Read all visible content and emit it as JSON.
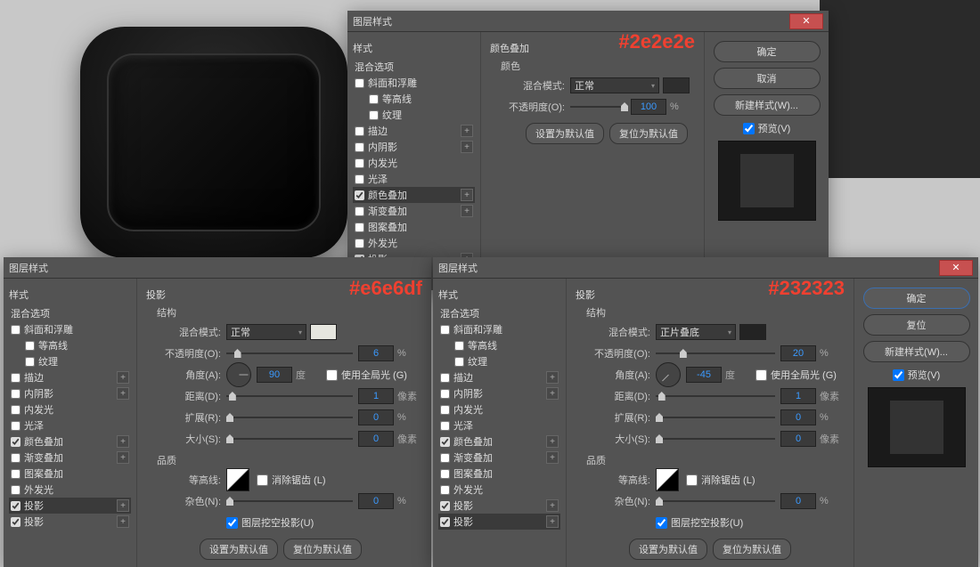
{
  "dialogTitle": "图层样式",
  "colors": {
    "anno1": "#2e2e2e",
    "anno2": "#e6e6df",
    "anno3": "#232323"
  },
  "styles": {
    "header": "样式",
    "blendOpts": "混合选项",
    "items": [
      {
        "k": "斜面和浮雕",
        "c": false,
        "p": false
      },
      {
        "k": "等高线",
        "c": false,
        "i": true,
        "p": false
      },
      {
        "k": "纹理",
        "c": false,
        "i": true,
        "p": false
      },
      {
        "k": "描边",
        "c": false,
        "p": true
      },
      {
        "k": "内阴影",
        "c": false,
        "p": true
      },
      {
        "k": "内发光",
        "c": false,
        "p": false
      },
      {
        "k": "光泽",
        "c": false,
        "p": false
      },
      {
        "k": "颜色叠加",
        "c": true,
        "p": true
      },
      {
        "k": "渐变叠加",
        "c": false,
        "p": true
      },
      {
        "k": "图案叠加",
        "c": false,
        "p": false
      },
      {
        "k": "外发光",
        "c": false,
        "p": false
      },
      {
        "k": "投影",
        "c": true,
        "p": true
      },
      {
        "k": "投影",
        "c": true,
        "p": true
      }
    ]
  },
  "colorOverlay": {
    "title": "颜色叠加",
    "sub": "颜色",
    "blendLabel": "混合模式:",
    "blendVal": "正常",
    "opLabel": "不透明度(O):",
    "opVal": "100",
    "opUnit": "%",
    "btnDefault": "设置为默认值",
    "btnReset": "复位为默认值",
    "swatch": "#2e2e2e"
  },
  "shadowA": {
    "title": "投影",
    "sub": "结构",
    "blendLabel": "混合模式:",
    "blendVal": "正常",
    "swatch": "#e6e6df",
    "opLabel": "不透明度(O):",
    "opVal": "6",
    "opUnit": "%",
    "angLabel": "角度(A):",
    "angVal": "90",
    "angUnit": "度",
    "globalLabel": "使用全局光 (G)",
    "global": false,
    "distLabel": "距离(D):",
    "distVal": "1",
    "distUnit": "像素",
    "sprLabel": "扩展(R):",
    "sprVal": "0",
    "sprUnit": "%",
    "sizeLabel": "大小(S):",
    "sizeVal": "0",
    "sizeUnit": "像素",
    "quality": "品质",
    "contLabel": "等高线:",
    "aaLabel": "消除锯齿 (L)",
    "aa": false,
    "noiseLabel": "杂色(N):",
    "noiseVal": "0",
    "noiseUnit": "%",
    "knockLabel": "图层挖空投影(U)",
    "knock": true,
    "btnDefault": "设置为默认值",
    "btnReset": "复位为默认值"
  },
  "shadowB": {
    "title": "投影",
    "sub": "结构",
    "blendLabel": "混合模式:",
    "blendVal": "正片叠底",
    "swatch": "#232323",
    "opLabel": "不透明度(O):",
    "opVal": "20",
    "opUnit": "%",
    "angLabel": "角度(A):",
    "angVal": "-45",
    "angUnit": "度",
    "globalLabel": "使用全局光 (G)",
    "global": false,
    "distLabel": "距离(D):",
    "distVal": "1",
    "distUnit": "像素",
    "sprLabel": "扩展(R):",
    "sprVal": "0",
    "sprUnit": "%",
    "sizeLabel": "大小(S):",
    "sizeVal": "0",
    "sizeUnit": "像素",
    "quality": "品质",
    "contLabel": "等高线:",
    "aaLabel": "消除锯齿 (L)",
    "aa": false,
    "noiseLabel": "杂色(N):",
    "noiseVal": "0",
    "noiseUnit": "%",
    "knockLabel": "图层挖空投影(U)",
    "knock": true,
    "btnDefault": "设置为默认值",
    "btnReset": "复位为默认值"
  },
  "buttons": {
    "ok": "确定",
    "cancel": "取消",
    "reset": "复位",
    "newStyle": "新建样式(W)...",
    "preview": "预览(V)"
  }
}
